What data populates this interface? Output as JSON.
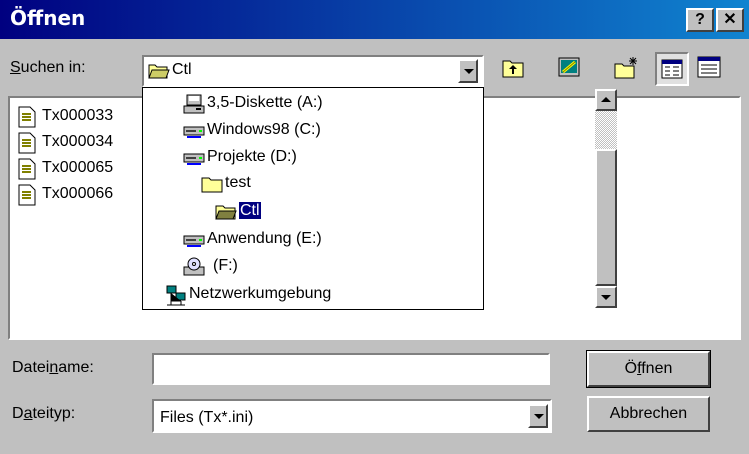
{
  "window": {
    "title": "Öffnen",
    "help_label": "?",
    "close_label": "✕"
  },
  "lookin": {
    "label_accel": "S",
    "label_rest": "uchen in:",
    "value": "Ctl",
    "folder_icon": "folder-open-icon"
  },
  "toolbar": {
    "up_icon": "up-one-level-icon",
    "desktop_icon": "desktop-icon",
    "new_folder_icon": "new-folder-icon",
    "list_icon": "list-view-icon",
    "details_icon": "details-view-icon"
  },
  "files": [
    {
      "name": "Tx000033",
      "icon": "ini-file-icon"
    },
    {
      "name": "Tx000034",
      "icon": "ini-file-icon"
    },
    {
      "name": "Tx000065",
      "icon": "ini-file-icon"
    },
    {
      "name": "Tx000066",
      "icon": "ini-file-icon"
    }
  ],
  "dropdown_items": [
    {
      "label": "3,5-Diskette (A:)",
      "icon": "floppy-drive-icon"
    },
    {
      "label": "Windows98 (C:)",
      "icon": "hard-drive-icon"
    },
    {
      "label": "Projekte (D:)",
      "icon": "hard-drive-icon"
    },
    {
      "label": "test",
      "icon": "folder-icon"
    },
    {
      "label": "Ctl",
      "icon": "folder-open-icon",
      "selected": true
    },
    {
      "label": "Anwendung (E:)",
      "icon": "hard-drive-icon"
    },
    {
      "label": "(F:)",
      "icon": "cd-drive-icon"
    },
    {
      "label": "Netzwerkumgebung",
      "icon": "network-icon"
    }
  ],
  "filename": {
    "label_pre": "Datei",
    "label_accel": "n",
    "label_post": "ame:",
    "value": ""
  },
  "filetype": {
    "label_pre": "D",
    "label_accel": "a",
    "label_post": "teityp:",
    "value": "Files (Tx*.ini)"
  },
  "buttons": {
    "open_pre": "Ö",
    "open_accel": "f",
    "open_post": "fnen",
    "cancel": "Abbrechen"
  },
  "colors": {
    "titlebar_start": "#000080",
    "titlebar_end": "#1084d0",
    "selection": "#000080",
    "face": "#c0c0c0"
  }
}
